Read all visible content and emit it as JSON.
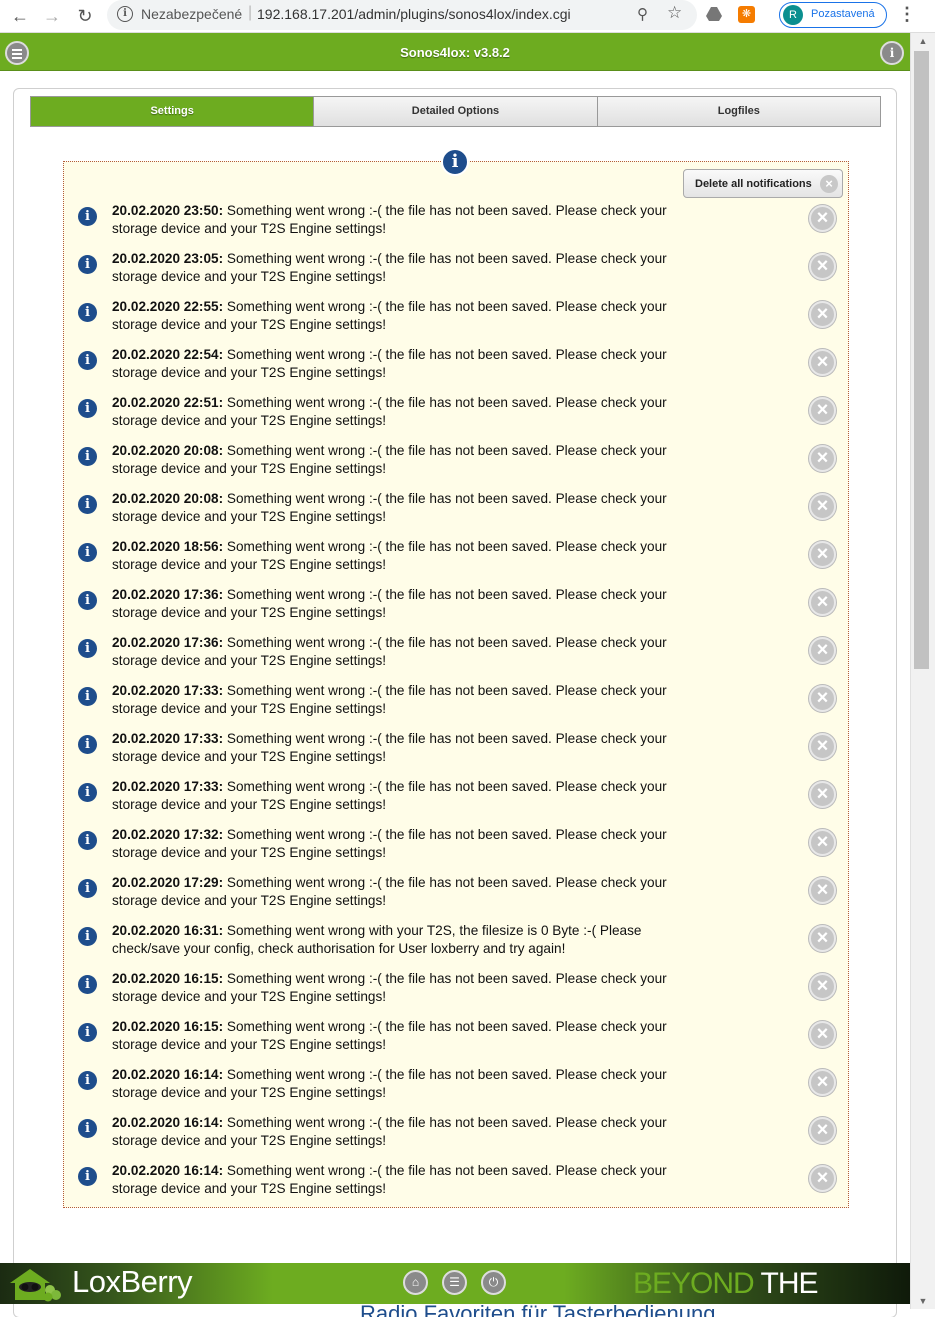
{
  "browser": {
    "security_label": "Nezabezpečené",
    "url": "192.168.17.201/admin/plugins/sonos4lox/index.cgi",
    "profile_initial": "R",
    "profile_label": "Pozastavená"
  },
  "header": {
    "title": "Sonos4lox: v3.8.2"
  },
  "tabs": [
    {
      "label": "Settings",
      "active": true
    },
    {
      "label": "Detailed Options",
      "active": false
    },
    {
      "label": "Logfiles",
      "active": false
    }
  ],
  "notifications": {
    "delete_all_label": "Delete all notifications",
    "items": [
      {
        "time": "20.02.2020 23:50:",
        "text": " Something went wrong :-( the file has not been saved. Please check your storage device and your T2S Engine settings!"
      },
      {
        "time": "20.02.2020 23:05:",
        "text": " Something went wrong :-( the file has not been saved. Please check your storage device and your T2S Engine settings!"
      },
      {
        "time": "20.02.2020 22:55:",
        "text": " Something went wrong :-( the file has not been saved. Please check your storage device and your T2S Engine settings!"
      },
      {
        "time": "20.02.2020 22:54:",
        "text": " Something went wrong :-( the file has not been saved. Please check your storage device and your T2S Engine settings!"
      },
      {
        "time": "20.02.2020 22:51:",
        "text": " Something went wrong :-( the file has not been saved. Please check your storage device and your T2S Engine settings!"
      },
      {
        "time": "20.02.2020 20:08:",
        "text": " Something went wrong :-( the file has not been saved. Please check your storage device and your T2S Engine settings!"
      },
      {
        "time": "20.02.2020 20:08:",
        "text": " Something went wrong :-( the file has not been saved. Please check your storage device and your T2S Engine settings!"
      },
      {
        "time": "20.02.2020 18:56:",
        "text": " Something went wrong :-( the file has not been saved. Please check your storage device and your T2S Engine settings!"
      },
      {
        "time": "20.02.2020 17:36:",
        "text": " Something went wrong :-( the file has not been saved. Please check your storage device and your T2S Engine settings!"
      },
      {
        "time": "20.02.2020 17:36:",
        "text": " Something went wrong :-( the file has not been saved. Please check your storage device and your T2S Engine settings!"
      },
      {
        "time": "20.02.2020 17:33:",
        "text": " Something went wrong :-( the file has not been saved. Please check your storage device and your T2S Engine settings!"
      },
      {
        "time": "20.02.2020 17:33:",
        "text": " Something went wrong :-( the file has not been saved. Please check your storage device and your T2S Engine settings!"
      },
      {
        "time": "20.02.2020 17:33:",
        "text": " Something went wrong :-( the file has not been saved. Please check your storage device and your T2S Engine settings!"
      },
      {
        "time": "20.02.2020 17:32:",
        "text": " Something went wrong :-( the file has not been saved. Please check your storage device and your T2S Engine settings!"
      },
      {
        "time": "20.02.2020 17:29:",
        "text": " Something went wrong :-( the file has not been saved. Please check your storage device and your T2S Engine settings!"
      },
      {
        "time": "20.02.2020 16:31:",
        "text": " Something went wrong with your T2S, the filesize is 0 Byte :-( Please check/save your config, check authorisation for User loxberry and try again!"
      },
      {
        "time": "20.02.2020 16:15:",
        "text": " Something went wrong :-( the file has not been saved. Please check your storage device and your T2S Engine settings!"
      },
      {
        "time": "20.02.2020 16:15:",
        "text": " Something went wrong :-( the file has not been saved. Please check your storage device and your T2S Engine settings!"
      },
      {
        "time": "20.02.2020 16:14:",
        "text": " Something went wrong :-( the file has not been saved. Please check your storage device and your T2S Engine settings!"
      },
      {
        "time": "20.02.2020 16:14:",
        "text": " Something went wrong :-( the file has not been saved. Please check your storage device and your T2S Engine settings!"
      },
      {
        "time": "20.02.2020 16:14:",
        "text": " Something went wrong :-( the file has not been saved. Please check your storage device and your T2S Engine settings!"
      }
    ]
  },
  "footer": {
    "brand": "LoxBerry",
    "slogan_1": "BEYOND",
    "slogan_2": " THE LIMITS"
  },
  "below_footer_text": "Radio Favoriten für Tasterbedienung",
  "colors": {
    "accent_green": "#6dac20",
    "info_blue": "#1e4d8c",
    "notification_bg": "#fffde8"
  }
}
